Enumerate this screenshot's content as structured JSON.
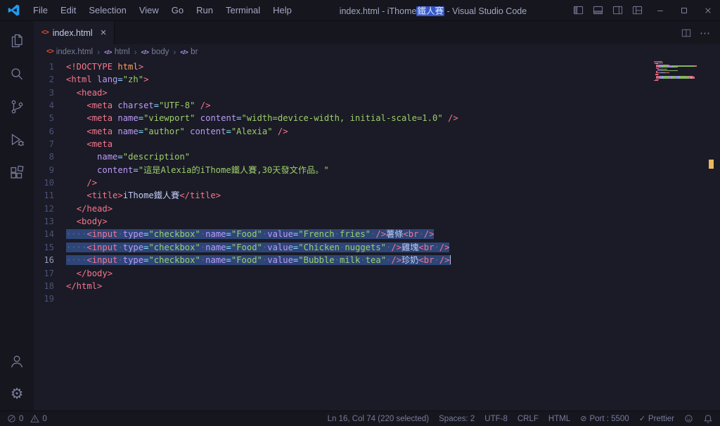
{
  "colors": {
    "bg": "#1a1b26",
    "chrome": "#16161e",
    "border": "#0d0d14",
    "fg": "#a2a8c3",
    "fg-dim": "#787c99",
    "selection": "#2e4577",
    "line-number": "#4a5175",
    "line-number-active": "#9099bd",
    "tag": "#f7768e",
    "attr": "#bb9af7",
    "value": "#9ece6a",
    "operator": "#89ddff",
    "doctype": "#ff9e64",
    "text": "#c0caf5",
    "whitespace": "#5a648e",
    "accent": "#1f9cf0",
    "html-orange": "#e44d26",
    "marker": "#e8b75f"
  },
  "icons": {
    "html_file": "<>",
    "symbol_tag": "</>",
    "ellipsis": "⋯"
  },
  "title_bar": {
    "menus": [
      "File",
      "Edit",
      "Selection",
      "View",
      "Go",
      "Run",
      "Terminal",
      "Help"
    ],
    "title_pre": "index.html - iThome",
    "title_highlight": "鐵人賽",
    "title_post": " - Visual Studio Code"
  },
  "activity_bar": {
    "items": [
      "explorer",
      "search",
      "source-control",
      "run-debug",
      "extensions"
    ],
    "bottom_items": [
      "account",
      "settings"
    ]
  },
  "tab_bar": {
    "tabs": [
      {
        "label": "index.html",
        "active": true
      }
    ],
    "close_glyph": "×"
  },
  "breadcrumb": {
    "file": "index.html",
    "separator": "›",
    "symbols": [
      "html",
      "body",
      "br"
    ]
  },
  "editor": {
    "active_line": 16,
    "cursor_line": 16,
    "lines": [
      {
        "selected": false,
        "tokens": [
          [
            "t",
            "<!DOCTYPE"
          ],
          [
            "d",
            " html"
          ],
          [
            "t",
            ">"
          ]
        ]
      },
      {
        "selected": false,
        "tokens": [
          [
            "t",
            "<html"
          ],
          [
            "a",
            " lang"
          ],
          [
            "o",
            "="
          ],
          [
            "v",
            "\"zh\""
          ],
          [
            "t",
            ">"
          ]
        ]
      },
      {
        "selected": false,
        "tokens": [
          [
            "x",
            "  "
          ],
          [
            "t",
            "<head>"
          ]
        ]
      },
      {
        "selected": false,
        "tokens": [
          [
            "x",
            "    "
          ],
          [
            "t",
            "<meta"
          ],
          [
            "a",
            " charset"
          ],
          [
            "o",
            "="
          ],
          [
            "v",
            "\"UTF-8\""
          ],
          [
            "t",
            " />"
          ]
        ]
      },
      {
        "selected": false,
        "tokens": [
          [
            "x",
            "    "
          ],
          [
            "t",
            "<meta"
          ],
          [
            "a",
            " name"
          ],
          [
            "o",
            "="
          ],
          [
            "v",
            "\"viewport\""
          ],
          [
            "a",
            " content"
          ],
          [
            "o",
            "="
          ],
          [
            "v",
            "\"width=device-width, initial-scale=1.0\""
          ],
          [
            "t",
            " />"
          ]
        ]
      },
      {
        "selected": false,
        "tokens": [
          [
            "x",
            "    "
          ],
          [
            "t",
            "<meta"
          ],
          [
            "a",
            " name"
          ],
          [
            "o",
            "="
          ],
          [
            "v",
            "\"author\""
          ],
          [
            "a",
            " content"
          ],
          [
            "o",
            "="
          ],
          [
            "v",
            "\"Alexia\""
          ],
          [
            "t",
            " />"
          ]
        ]
      },
      {
        "selected": false,
        "tokens": [
          [
            "x",
            "    "
          ],
          [
            "t",
            "<meta"
          ]
        ]
      },
      {
        "selected": false,
        "tokens": [
          [
            "x",
            "      "
          ],
          [
            "a",
            "name"
          ],
          [
            "o",
            "="
          ],
          [
            "v",
            "\"description\""
          ]
        ]
      },
      {
        "selected": false,
        "tokens": [
          [
            "x",
            "      "
          ],
          [
            "a",
            "content"
          ],
          [
            "o",
            "="
          ],
          [
            "v",
            "\"這是Alexia的iThome鐵人賽,30天發文作品。\""
          ]
        ]
      },
      {
        "selected": false,
        "tokens": [
          [
            "x",
            "    "
          ],
          [
            "t",
            "/>"
          ]
        ]
      },
      {
        "selected": false,
        "tokens": [
          [
            "x",
            "    "
          ],
          [
            "t",
            "<title>"
          ],
          [
            "x",
            "iThome鐵人賽"
          ],
          [
            "t",
            "</title>"
          ]
        ]
      },
      {
        "selected": false,
        "tokens": [
          [
            "x",
            "  "
          ],
          [
            "t",
            "</head>"
          ]
        ]
      },
      {
        "selected": false,
        "tokens": [
          [
            "x",
            "  "
          ],
          [
            "t",
            "<body>"
          ]
        ]
      },
      {
        "selected": true,
        "tokens": [
          [
            "x",
            "    "
          ],
          [
            "t",
            "<input"
          ],
          [
            "a",
            " type"
          ],
          [
            "o",
            "="
          ],
          [
            "v",
            "\"checkbox\""
          ],
          [
            "a",
            " name"
          ],
          [
            "o",
            "="
          ],
          [
            "v",
            "\"Food\""
          ],
          [
            "a",
            " value"
          ],
          [
            "o",
            "="
          ],
          [
            "v",
            "\"French fries\""
          ],
          [
            "t",
            " />"
          ],
          [
            "x",
            "薯條"
          ],
          [
            "t",
            "<br />"
          ]
        ]
      },
      {
        "selected": true,
        "tokens": [
          [
            "x",
            "    "
          ],
          [
            "t",
            "<input"
          ],
          [
            "a",
            " type"
          ],
          [
            "o",
            "="
          ],
          [
            "v",
            "\"checkbox\""
          ],
          [
            "a",
            " name"
          ],
          [
            "o",
            "="
          ],
          [
            "v",
            "\"Food\""
          ],
          [
            "a",
            " value"
          ],
          [
            "o",
            "="
          ],
          [
            "v",
            "\"Chicken nuggets\""
          ],
          [
            "t",
            " />"
          ],
          [
            "x",
            "雞塊"
          ],
          [
            "t",
            "<br />"
          ]
        ]
      },
      {
        "selected": true,
        "tokens": [
          [
            "x",
            "    "
          ],
          [
            "t",
            "<input"
          ],
          [
            "a",
            " type"
          ],
          [
            "o",
            "="
          ],
          [
            "v",
            "\"checkbox\""
          ],
          [
            "a",
            " name"
          ],
          [
            "o",
            "="
          ],
          [
            "v",
            "\"Food\""
          ],
          [
            "a",
            " value"
          ],
          [
            "o",
            "="
          ],
          [
            "v",
            "\"Bubble milk tea\""
          ],
          [
            "t",
            " />"
          ],
          [
            "x",
            "珍奶"
          ],
          [
            "t",
            "<br />"
          ]
        ]
      },
      {
        "selected": false,
        "tokens": [
          [
            "x",
            "  "
          ],
          [
            "t",
            "</body>"
          ]
        ]
      },
      {
        "selected": false,
        "tokens": [
          [
            "t",
            "</html>"
          ]
        ]
      },
      {
        "selected": false,
        "tokens": []
      }
    ]
  },
  "status_bar": {
    "problems": {
      "errors": "0",
      "warnings": "0"
    },
    "items": [
      {
        "name": "cursor-position",
        "label": "Ln 16, Col 74 (220 selected)"
      },
      {
        "name": "indentation",
        "label": "Spaces: 2"
      },
      {
        "name": "encoding",
        "label": "UTF-8"
      },
      {
        "name": "eol",
        "label": "CRLF"
      },
      {
        "name": "language-mode",
        "label": "HTML"
      },
      {
        "name": "live-server-port",
        "label": "Port : 5500",
        "icon": "⊘"
      },
      {
        "name": "prettier",
        "label": "Prettier",
        "icon": "✓"
      }
    ]
  }
}
